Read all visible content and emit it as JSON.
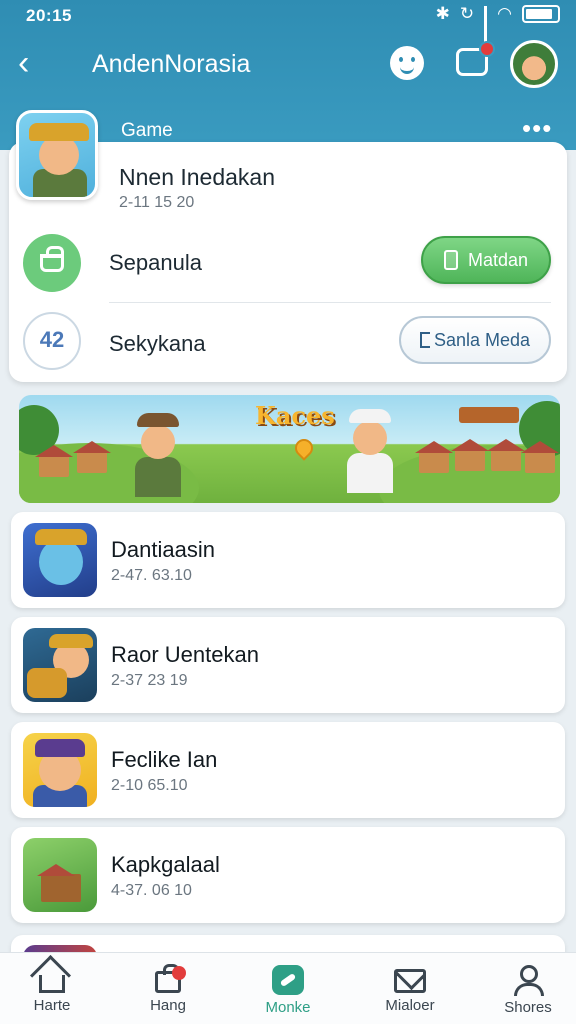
{
  "status": {
    "time": "20:15"
  },
  "appbar": {
    "title": "AndenNorasia"
  },
  "header": {
    "section_label": "Game"
  },
  "featured": {
    "title": "Nnen Inedakan",
    "date": "2-11 15 20",
    "row1": {
      "label": "Sepanula",
      "button_label": "Matdan"
    },
    "row2": {
      "label": "Sekykana",
      "icon_text": "42",
      "button_label": "Sanla Meda"
    }
  },
  "banner": {
    "title": "Kaces"
  },
  "items": [
    {
      "title": "Dantiaasin",
      "date": "2-47. 63.10"
    },
    {
      "title": "Raor Uentekan",
      "date": "2-37 23 19"
    },
    {
      "title": "Feclike Ian",
      "date": "2-10 65.10"
    },
    {
      "title": "Kapkgalaal",
      "date": "4-37. 06 10"
    }
  ],
  "tabs": [
    {
      "label": "Harte"
    },
    {
      "label": "Hang"
    },
    {
      "label": "Monke"
    },
    {
      "label": "Mialoer"
    },
    {
      "label": "Shores"
    }
  ],
  "colors": {
    "accent": "#2e9f86",
    "header": "#3a9bc0",
    "primary_button": "#4fb559",
    "badge": "#e23c3c"
  }
}
